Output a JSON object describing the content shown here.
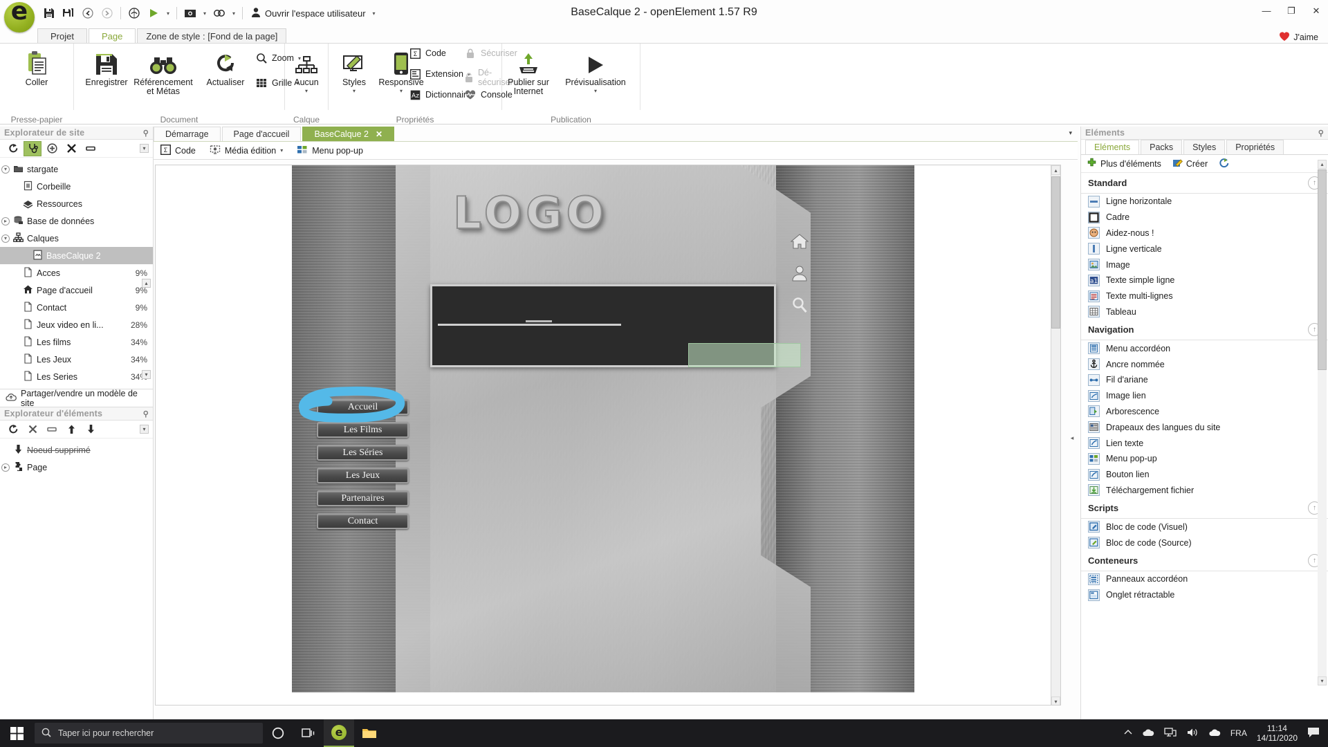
{
  "window": {
    "title": "BaseCalque 2 - openElement 1.57 R9",
    "minimize": "—",
    "maximize": "❐",
    "close": "✕",
    "like_label": "J'aime"
  },
  "quick_access": {
    "user_space": "Ouvrir l'espace utilisateur",
    "buttons": [
      "save-icon",
      "save-all-icon",
      "undo-icon",
      "redo-icon",
      "browser-preview-icon",
      "run-icon",
      "screenshot-icon",
      "link-icon"
    ]
  },
  "ribbon_tabs": [
    {
      "label": "Projet",
      "active": false
    },
    {
      "label": "Page",
      "active": true
    },
    {
      "label": "Zone de style : [Fond de la page]",
      "active": false
    }
  ],
  "ribbon": {
    "groups": [
      {
        "label": "Presse-papier"
      },
      {
        "label": "Document"
      },
      {
        "label": "Calque"
      },
      {
        "label": "Propriétés"
      },
      {
        "label": "Publication"
      }
    ],
    "paste": "Coller",
    "save": "Enregistrer",
    "seo": "Référencement\net Métas",
    "seo_line1": "Référencement",
    "seo_line2": "et Métas",
    "refresh": "Actualiser",
    "zoom": "Zoom",
    "grid": "Grille",
    "none": "Aucun",
    "styles": "Styles",
    "responsive": "Responsive",
    "code": "Code",
    "extension": "Extension",
    "dictionary": "Dictionnaire",
    "secure": "Sécuriser",
    "unsecure": "Dé-sécuriser",
    "console": "Console",
    "publish_line1": "Publier sur",
    "publish_line2": "Internet",
    "preview": "Prévisualisation"
  },
  "site_explorer": {
    "title": "Explorateur de site",
    "toolbar": [
      "refresh-icon",
      "stethoscope-icon",
      "add-icon",
      "delete-icon",
      "rename-icon",
      "options-icon"
    ],
    "tree": [
      {
        "label": "stargate",
        "icon": "site-icon",
        "depth": 0,
        "expander": "▾",
        "pct": "",
        "selected": false
      },
      {
        "label": "Corbeille",
        "icon": "trash-icon",
        "depth": 1,
        "expander": "",
        "pct": "",
        "selected": false
      },
      {
        "label": "Ressources",
        "icon": "resources-icon",
        "depth": 1,
        "expander": "",
        "pct": "",
        "selected": false
      },
      {
        "label": "Base de données",
        "icon": "database-icon",
        "depth": 0,
        "expander": "▸",
        "pct": "",
        "selected": false
      },
      {
        "label": "Calques",
        "icon": "layers-icon",
        "depth": 0,
        "expander": "▾",
        "pct": "",
        "selected": false
      },
      {
        "label": "BaseCalque 2",
        "icon": "layer-icon",
        "depth": 2,
        "expander": "",
        "pct": "",
        "selected": true
      },
      {
        "label": "Acces",
        "icon": "page-icon",
        "depth": 1,
        "expander": "",
        "pct": "9%",
        "selected": false
      },
      {
        "label": "Page d'accueil",
        "icon": "home-icon",
        "depth": 1,
        "expander": "",
        "pct": "9%",
        "selected": false
      },
      {
        "label": "Contact",
        "icon": "page-icon",
        "depth": 1,
        "expander": "",
        "pct": "9%",
        "selected": false
      },
      {
        "label": "Jeux video en li...",
        "icon": "page-icon",
        "depth": 1,
        "expander": "",
        "pct": "28%",
        "selected": false
      },
      {
        "label": "Les films",
        "icon": "page-icon",
        "depth": 1,
        "expander": "",
        "pct": "34%",
        "selected": false
      },
      {
        "label": "Les Jeux",
        "icon": "page-icon",
        "depth": 1,
        "expander": "",
        "pct": "34%",
        "selected": false
      },
      {
        "label": "Les Series",
        "icon": "page-icon",
        "depth": 1,
        "expander": "",
        "pct": "34%",
        "selected": false
      }
    ],
    "share": "Partager/vendre un modèle de site"
  },
  "element_explorer": {
    "title": "Explorateur d'éléments",
    "toolbar": [
      "refresh-icon",
      "delete-icon",
      "rename-icon",
      "move-up-icon",
      "move-down-icon",
      "options-icon"
    ],
    "items": [
      {
        "label": "Noeud supprimé",
        "icon": "down-arrow-icon",
        "struck": true,
        "expander": ""
      },
      {
        "label": "Page",
        "icon": "puzzle-icon",
        "struck": false,
        "expander": "▸"
      }
    ]
  },
  "document_tabs": [
    {
      "label": "Démarrage",
      "active": false,
      "closable": false
    },
    {
      "label": "Page d'accueil",
      "active": false,
      "closable": false
    },
    {
      "label": "BaseCalque 2",
      "active": true,
      "closable": true,
      "close": "✕"
    }
  ],
  "document_toolbar": [
    {
      "label": "Code",
      "icon": "code-icon",
      "caret": false
    },
    {
      "label": "Média édition",
      "icon": "media-icon",
      "caret": true
    },
    {
      "label": "Menu pop-up",
      "icon": "popup-menu-icon",
      "caret": false
    }
  ],
  "canvas": {
    "logo_text": "LOGO",
    "nav_buttons": [
      "Accueil",
      "Les Films",
      "Les Séries",
      "Les Jeux",
      "Partenaires",
      "Contact"
    ],
    "side_icons": [
      "home-icon",
      "user-icon",
      "search-icon"
    ],
    "highlight_color": "#54b9e8",
    "highlighted_button": "Accueil"
  },
  "right_panel": {
    "title": "Eléments",
    "tabs": [
      {
        "label": "Eléments",
        "active": true
      },
      {
        "label": "Packs",
        "active": false
      },
      {
        "label": "Styles",
        "active": false
      },
      {
        "label": "Propriétés",
        "active": false
      }
    ],
    "actions": [
      {
        "label": "Plus d'éléments",
        "icon": "plus-icon"
      },
      {
        "label": "Créer",
        "icon": "create-icon"
      },
      {
        "label": "",
        "icon": "refresh-icon"
      }
    ],
    "sections": [
      {
        "title": "Standard",
        "items": [
          {
            "label": "Ligne horizontale",
            "icon": "hr-icon"
          },
          {
            "label": "Cadre",
            "icon": "frame-icon"
          },
          {
            "label": "Aidez-nous !",
            "icon": "help-icon"
          },
          {
            "label": "Ligne verticale",
            "icon": "vr-icon"
          },
          {
            "label": "Image",
            "icon": "image-icon"
          },
          {
            "label": "Texte simple ligne",
            "icon": "text-single-icon"
          },
          {
            "label": "Texte multi-lignes",
            "icon": "text-multi-icon"
          },
          {
            "label": "Tableau",
            "icon": "table-icon"
          }
        ]
      },
      {
        "title": "Navigation",
        "items": [
          {
            "label": "Menu accordéon",
            "icon": "accordion-menu-icon"
          },
          {
            "label": "Ancre nommée",
            "icon": "anchor-icon"
          },
          {
            "label": "Fil d'ariane",
            "icon": "breadcrumb-icon"
          },
          {
            "label": "Image lien",
            "icon": "image-link-icon"
          },
          {
            "label": "Arborescence",
            "icon": "tree-icon"
          },
          {
            "label": "Drapeaux des langues du site",
            "icon": "flags-icon"
          },
          {
            "label": "Lien texte",
            "icon": "text-link-icon"
          },
          {
            "label": "Menu pop-up",
            "icon": "popup-menu-icon"
          },
          {
            "label": "Bouton lien",
            "icon": "link-button-icon"
          },
          {
            "label": "Téléchargement fichier",
            "icon": "download-icon"
          }
        ]
      },
      {
        "title": "Scripts",
        "items": [
          {
            "label": "Bloc de code (Visuel)",
            "icon": "code-visual-icon"
          },
          {
            "label": "Bloc de code (Source)",
            "icon": "code-source-icon"
          }
        ]
      },
      {
        "title": "Conteneurs",
        "items": [
          {
            "label": "Panneaux accordéon",
            "icon": "accordion-panel-icon"
          },
          {
            "label": "Onglet rétractable",
            "icon": "collapsible-tab-icon"
          }
        ]
      }
    ]
  },
  "taskbar": {
    "search_placeholder": "Taper ici pour rechercher",
    "buttons": [
      "cortana-icon",
      "task-view-icon",
      "openelement-icon",
      "explorer-icon"
    ],
    "tray": [
      "chevron-up-icon",
      "onedrive-icon",
      "network-icon",
      "volume-icon",
      "cloud-icon"
    ],
    "language": "FRA",
    "time": "11:14",
    "date": "14/11/2020",
    "notification": "notification-icon"
  }
}
